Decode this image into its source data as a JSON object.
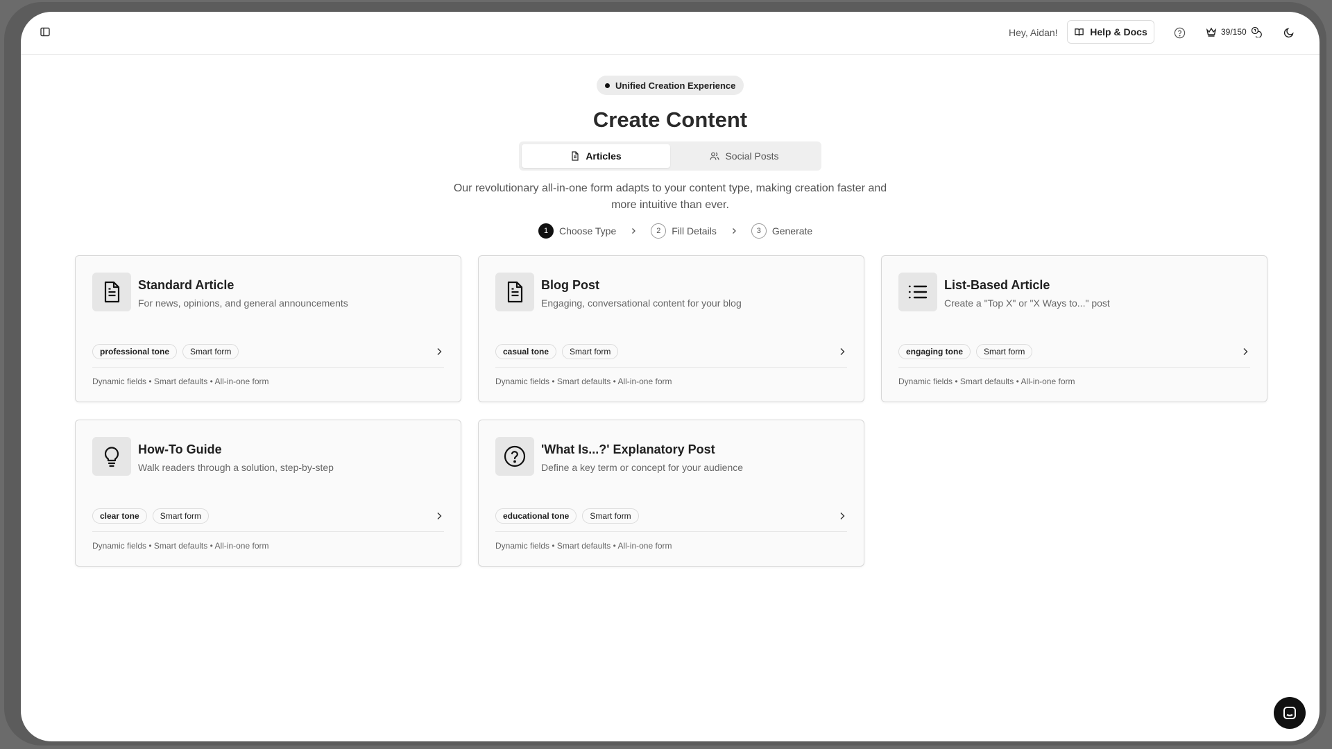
{
  "header": {
    "greeting": "Hey, Aidan!",
    "help_label": "Help & Docs",
    "credits": "39/150"
  },
  "hero": {
    "pill": "Unified Creation Experience",
    "title": "Create Content",
    "tabs": [
      {
        "label": "Articles",
        "active": true
      },
      {
        "label": "Social Posts",
        "active": false
      }
    ],
    "description": "Our revolutionary all-in-one form adapts to your content type, making creation faster and more intuitive than ever."
  },
  "steps": [
    {
      "num": "1",
      "label": "Choose Type",
      "active": true
    },
    {
      "num": "2",
      "label": "Fill Details",
      "active": false
    },
    {
      "num": "3",
      "label": "Generate",
      "active": false
    }
  ],
  "cards": [
    {
      "title": "Standard Article",
      "subtitle": "For news, opinions, and general announcements",
      "tone": "professional tone",
      "form": "Smart form",
      "footer": "Dynamic fields • Smart defaults • All-in-one form",
      "icon": "document-icon"
    },
    {
      "title": "Blog Post",
      "subtitle": "Engaging, conversational content for your blog",
      "tone": "casual tone",
      "form": "Smart form",
      "footer": "Dynamic fields • Smart defaults • All-in-one form",
      "icon": "document-icon"
    },
    {
      "title": "List-Based Article",
      "subtitle": "Create a \"Top X\" or \"X Ways to...\" post",
      "tone": "engaging tone",
      "form": "Smart form",
      "footer": "Dynamic fields • Smart defaults • All-in-one form",
      "icon": "list-icon"
    },
    {
      "title": "How-To Guide",
      "subtitle": "Walk readers through a solution, step-by-step",
      "tone": "clear tone",
      "form": "Smart form",
      "footer": "Dynamic fields • Smart defaults • All-in-one form",
      "icon": "lightbulb-icon"
    },
    {
      "title": "'What Is...?' Explanatory Post",
      "subtitle": "Define a key term or concept for your audience",
      "tone": "educational tone",
      "form": "Smart form",
      "footer": "Dynamic fields • Smart defaults • All-in-one form",
      "icon": "question-circle-icon"
    }
  ]
}
